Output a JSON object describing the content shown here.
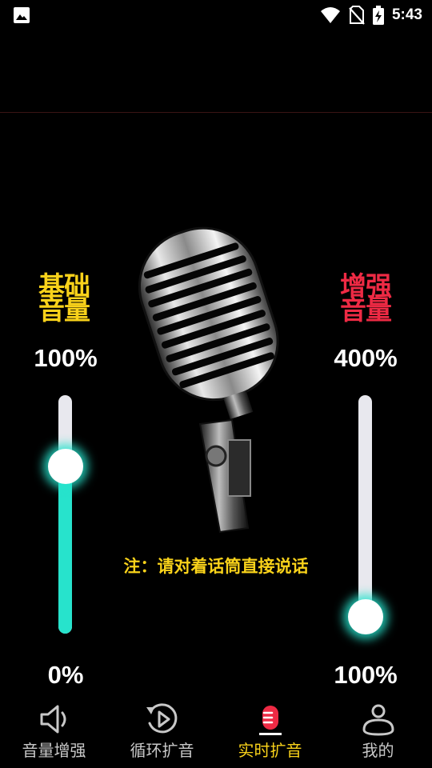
{
  "status_bar": {
    "time": "5:43",
    "icons": [
      "gallery-icon",
      "wifi-icon",
      "no-sim-icon",
      "battery-charging-icon"
    ]
  },
  "base_volume": {
    "title_line1": "基础",
    "title_line2": "音量",
    "max_label": "100%",
    "min_label": "0%",
    "level": 0.7,
    "color": "#f9d21a"
  },
  "boost_volume": {
    "title_line1": "增强",
    "title_line2": "音量",
    "max_label": "400%",
    "min_label": "100%",
    "level": 0.07,
    "color": "#ee2a44"
  },
  "slider_colors": {
    "track": "#e8e8ee",
    "fill": "#27e3cc",
    "thumb": "#ffffff"
  },
  "note": "注：请对着话筒直接说话",
  "nav": {
    "items": [
      {
        "label": "音量增强",
        "icon": "speaker-icon",
        "active": false
      },
      {
        "label": "循环扩音",
        "icon": "loop-play-icon",
        "active": false
      },
      {
        "label": "实时扩音",
        "icon": "microphone-icon",
        "active": true
      },
      {
        "label": "我的",
        "icon": "profile-icon",
        "active": false
      }
    ],
    "active_color": "#f9d21a"
  }
}
